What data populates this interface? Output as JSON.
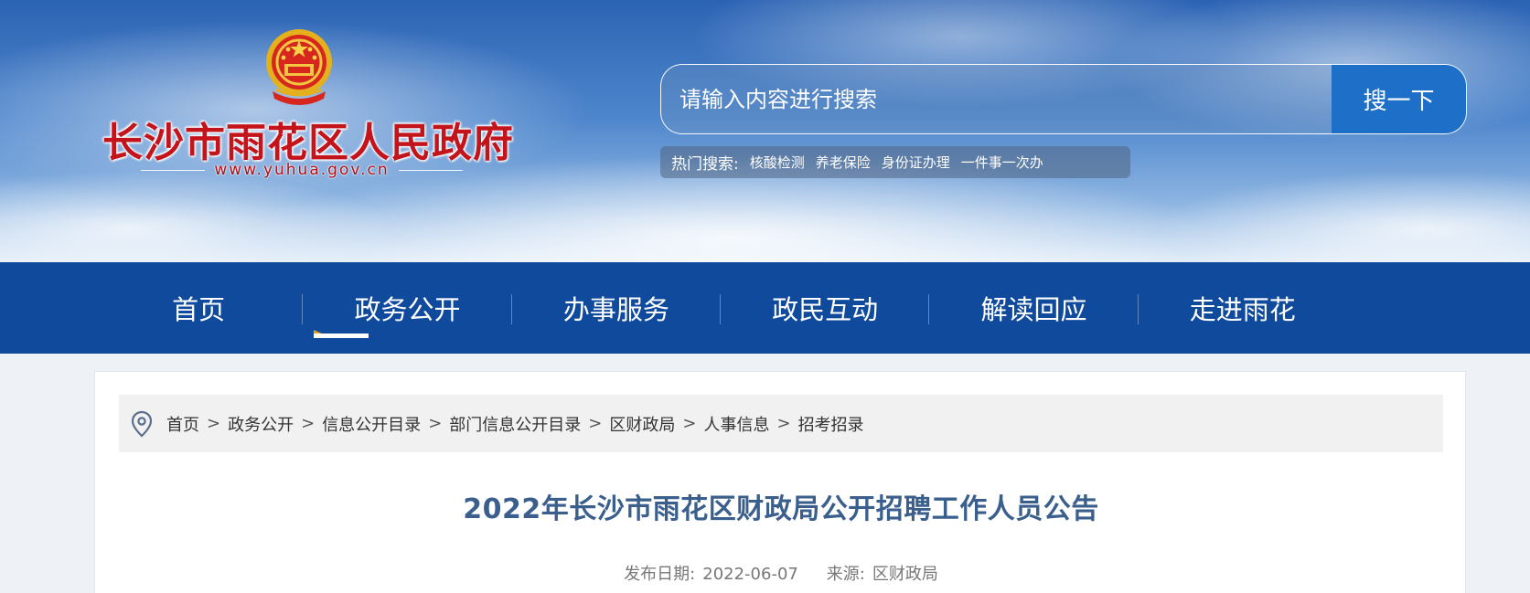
{
  "header": {
    "site_title": "长沙市雨花区人民政府",
    "site_url": "www.yuhua.gov.cn"
  },
  "search": {
    "placeholder": "请输入内容进行搜索",
    "button_label": "搜一下"
  },
  "hot_search": {
    "label": "热门搜索:",
    "items": [
      "核酸检测",
      "养老保险",
      "身份证办理",
      "一件事一次办"
    ]
  },
  "nav": {
    "items": [
      "首页",
      "政务公开",
      "办事服务",
      "政民互动",
      "解读回应",
      "走进雨花"
    ],
    "active": "政务公开"
  },
  "breadcrumb": {
    "icon": "location-pin-icon",
    "items": [
      "首页",
      "政务公开",
      "信息公开目录",
      "部门信息公开目录",
      "区财政局",
      "人事信息",
      "招考招录"
    ],
    "separator": ">"
  },
  "article": {
    "title": "2022年长沙市雨花区财政局公开招聘工作人员公告",
    "date_label": "发布日期:",
    "date": "2022-06-07",
    "source_label": "来源:",
    "source": "区财政局"
  },
  "colors": {
    "nav_bg": "#0f4a9c",
    "search_button": "#1e6fc8",
    "title_red": "#c3141b",
    "article_title": "#3a5f8d",
    "indicator_accent": "#e8a11b"
  }
}
